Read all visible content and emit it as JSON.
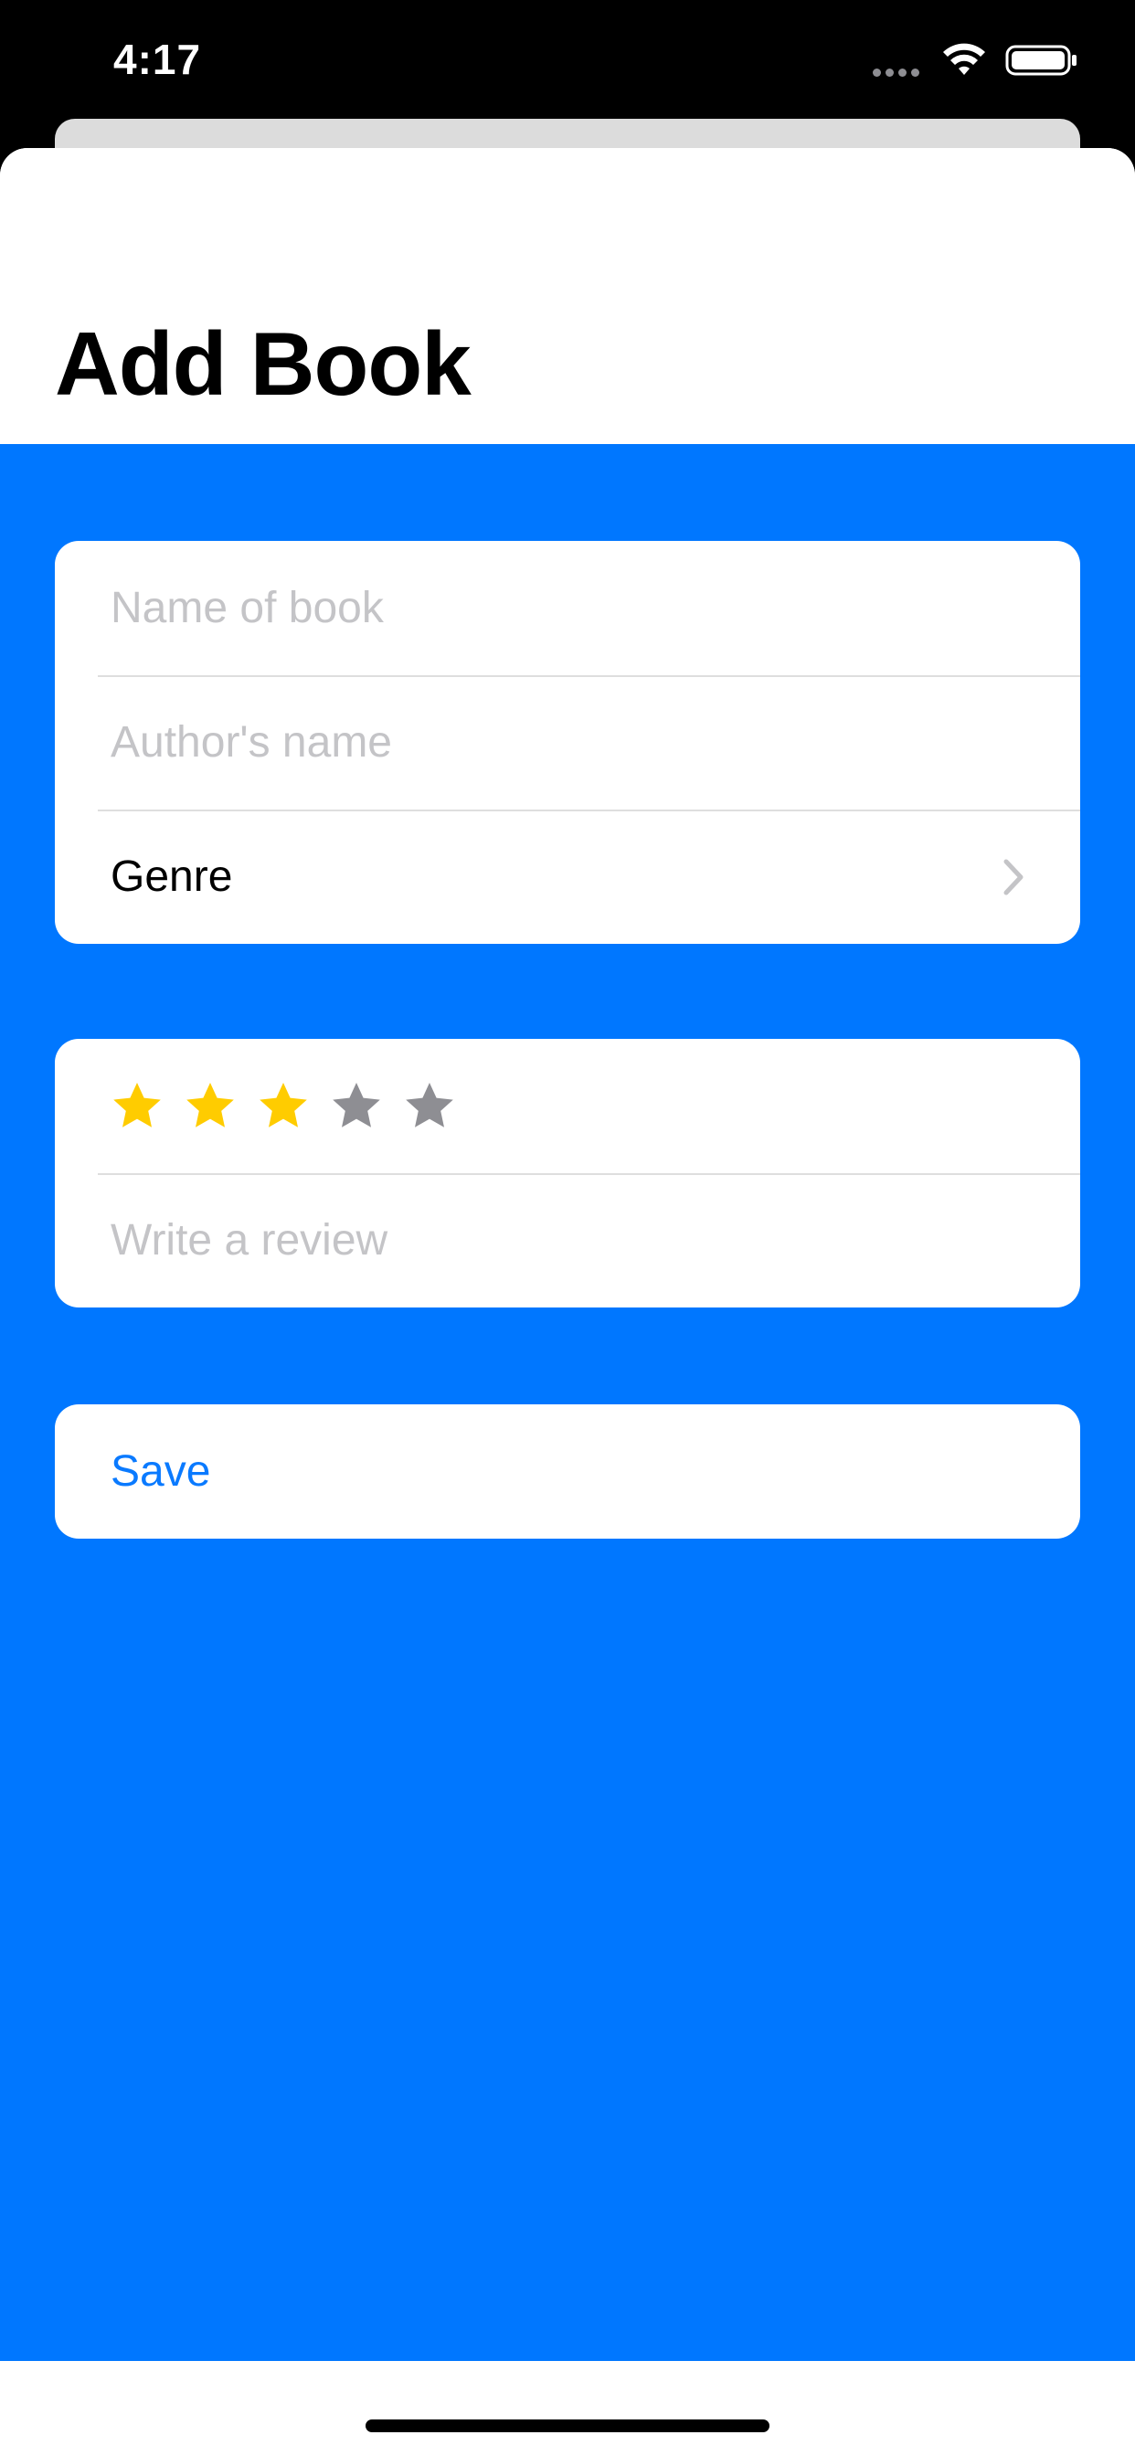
{
  "status_bar": {
    "time": "4:17"
  },
  "header": {
    "title": "Add Book"
  },
  "book_info": {
    "name_placeholder": "Name of book",
    "author_placeholder": "Author's name",
    "genre_label": "Genre"
  },
  "review": {
    "rating": 3,
    "max_rating": 5,
    "filled_color": "#ffcc00",
    "empty_color": "#8e8e93",
    "review_placeholder": "Write a review"
  },
  "actions": {
    "save_label": "Save"
  },
  "colors": {
    "form_background": "#0077ff",
    "accent": "#0a7aff"
  },
  "icons": {
    "status": [
      "signal-dots-icon",
      "wifi-icon",
      "battery-icon"
    ],
    "genre_row": "chevron-right-icon",
    "rating": "star-icon"
  }
}
